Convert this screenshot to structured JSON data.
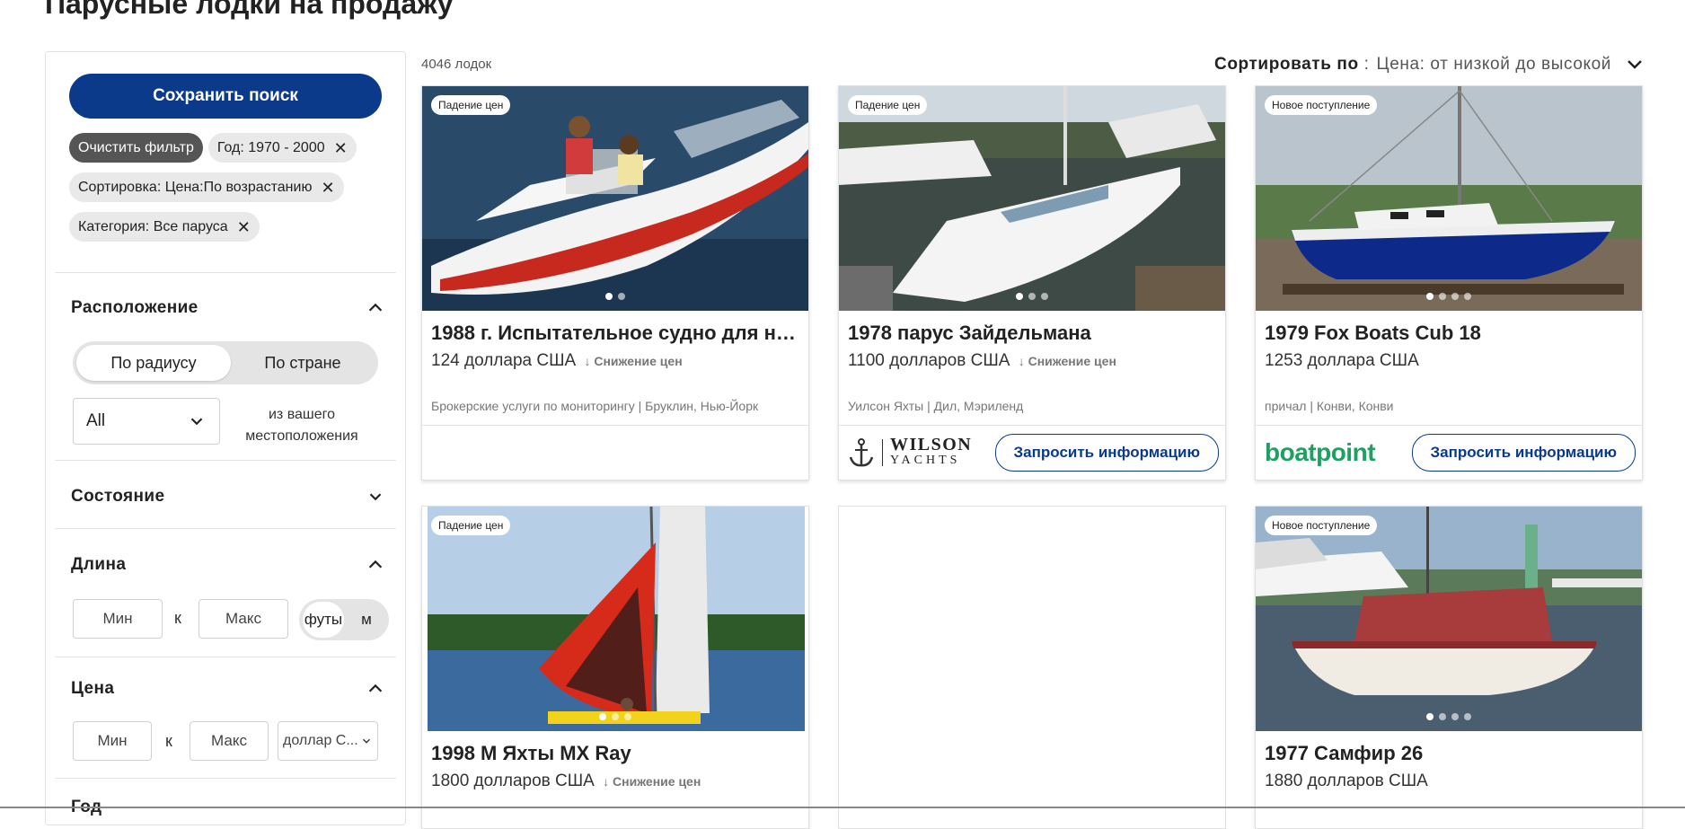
{
  "page": {
    "title": "Парусные лодки на продажу"
  },
  "sidebar": {
    "save_search": "Сохранить поиск",
    "chips": [
      {
        "label": "Очистить фильтр",
        "removable": false
      },
      {
        "label": "Год: 1970 - 2000",
        "removable": true
      },
      {
        "label": "Сортировка: Цена:По возрастанию",
        "removable": true
      },
      {
        "label": "Категория: Все паруса",
        "removable": true
      }
    ],
    "location": {
      "title": "Расположение",
      "options": [
        "По радиусу",
        "По стране"
      ],
      "radius_value": "All",
      "from_location": "из вашего местоположения"
    },
    "condition": {
      "title": "Состояние"
    },
    "length": {
      "title": "Длина",
      "min_placeholder": "Мин",
      "to": "к",
      "max_placeholder": "Макс",
      "unit_feet": "футы",
      "unit_m": "м"
    },
    "price": {
      "title": "Цена",
      "min_placeholder": "Мин",
      "to": "к",
      "max_placeholder": "Макс",
      "currency": "доллар С..."
    },
    "year": {
      "title": "Год"
    }
  },
  "results": {
    "count": "4046 лодок",
    "sort_label": "Сортировать по",
    "sort_value": "Цена: от низкой до высокой",
    "listings": [
      {
        "badge": "Падение цен",
        "title": "1988 г. Испытательное судно для на...",
        "price": "124 доллара США",
        "drop": "↓ Снижение цен",
        "seller": "Брокерские услуги по мониторингу | Бруклин, Нью-Йорк",
        "cta": "",
        "logo": ""
      },
      {
        "badge": "Падение цен",
        "title": "1978 парус Зайдельмана",
        "price": "1100 долларов США",
        "drop": "↓ Снижение цен",
        "seller": "Уилсон Яхты | Дил, Мэриленд",
        "cta": "Запросить информацию",
        "logo": "WILSON YACHTS"
      },
      {
        "badge": "Новое поступление",
        "title": "1979 Fox Boats Cub 18",
        "price": "1253 доллара США",
        "drop": "",
        "seller": "причал | Конви, Конви",
        "cta": "Запросить информацию",
        "logo": "boatpoint"
      },
      {
        "badge": "Падение цен",
        "title": "1998 M Яхты MX Ray",
        "price": "1800 долларов США",
        "drop": "↓ Снижение цен",
        "seller": "",
        "cta": "",
        "logo": ""
      },
      {
        "badge": "Новое поступление",
        "title": "1977 Самфир 26",
        "price": "1880 долларов США",
        "drop": "",
        "seller": "",
        "cta": "",
        "logo": ""
      }
    ]
  },
  "colors": {
    "primary": "#0b3a8a",
    "boatpoint": "#1fa060"
  }
}
